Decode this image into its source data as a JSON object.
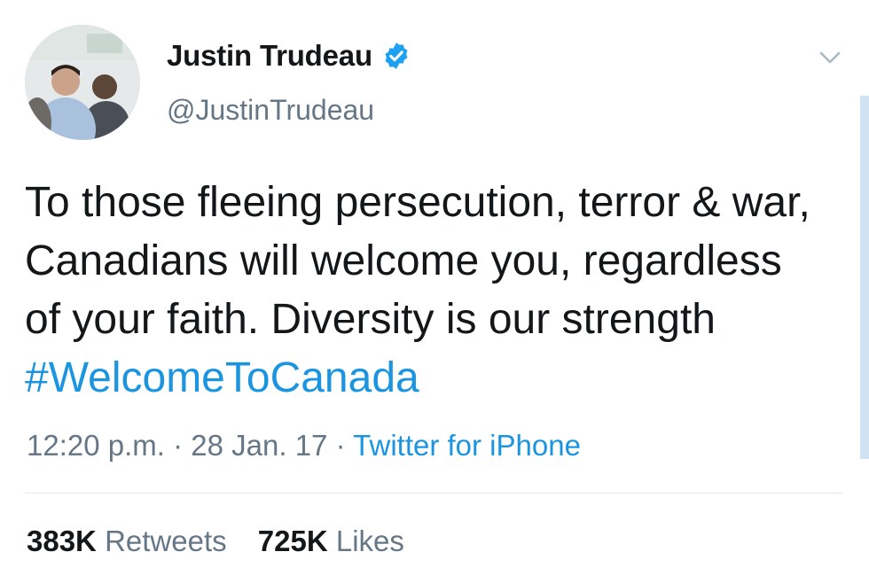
{
  "author": {
    "display_name": "Justin Trudeau",
    "handle": "@JustinTrudeau",
    "verified": true
  },
  "tweet": {
    "text_before_hashtag": "To those fleeing persecution, terror & war, Canadians will welcome you, regardless of your faith. Diversity is our strength ",
    "hashtag": "#WelcomeToCanada"
  },
  "meta": {
    "time": "12:20 p.m.",
    "date": "28 Jan. 17",
    "separator": "·",
    "source": "Twitter for iPhone"
  },
  "stats": {
    "retweets_count": "383K",
    "retweets_label": "Retweets",
    "likes_count": "725K",
    "likes_label": "Likes"
  },
  "icons": {
    "verified": "verified-badge-icon",
    "menu": "chevron-down-icon"
  },
  "colors": {
    "link": "#1b95e0",
    "secondary_text": "#657786",
    "primary_text": "#14171a",
    "divider": "#e1e8ed"
  }
}
